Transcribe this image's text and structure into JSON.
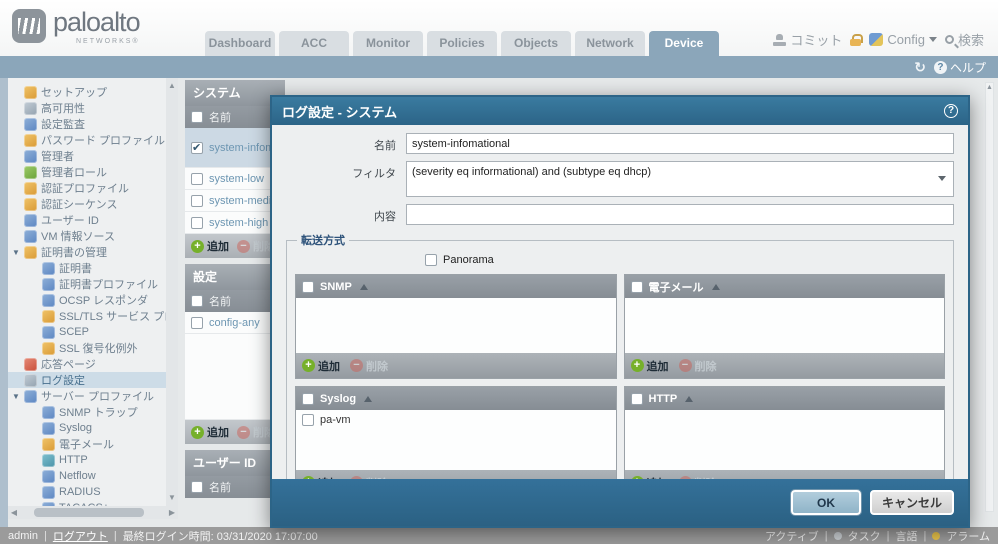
{
  "header": {
    "logo": {
      "brand": "paloalto",
      "sub": "NETWORKS®"
    },
    "tabs": [
      "Dashboard",
      "ACC",
      "Monitor",
      "Policies",
      "Objects",
      "Network",
      "Device"
    ],
    "active_tab": "Device",
    "utilities": {
      "commit": "コミット",
      "config": "Config",
      "search": "検索"
    }
  },
  "toolbar": {
    "help": "ヘルプ"
  },
  "sidebar": {
    "items": [
      {
        "label": "セットアップ"
      },
      {
        "label": "高可用性"
      },
      {
        "label": "設定監査"
      },
      {
        "label": "パスワード プロファイル"
      },
      {
        "label": "管理者"
      },
      {
        "label": "管理者ロール"
      },
      {
        "label": "認証プロファイル"
      },
      {
        "label": "認証シーケンス"
      },
      {
        "label": "ユーザー ID"
      },
      {
        "label": "VM 情報ソース"
      },
      {
        "label": "証明書の管理",
        "expanded": true
      },
      {
        "label": "証明書"
      },
      {
        "label": "証明書プロファイル"
      },
      {
        "label": "OCSP レスポンダ"
      },
      {
        "label": "SSL/TLS サービス プロファイル"
      },
      {
        "label": "SCEP"
      },
      {
        "label": "SSL 復号化例外"
      },
      {
        "label": "応答ページ"
      },
      {
        "label": "ログ設定",
        "selected": true
      },
      {
        "label": "サーバー プロファイル",
        "expanded": true
      },
      {
        "label": "SNMP トラップ"
      },
      {
        "label": "Syslog"
      },
      {
        "label": "電子メール"
      },
      {
        "label": "HTTP"
      },
      {
        "label": "Netflow"
      },
      {
        "label": "RADIUS"
      },
      {
        "label": "TACACS+"
      }
    ],
    "expander_glyph": "▼"
  },
  "actions": {
    "add": "追加",
    "remove": "削除"
  },
  "middle": {
    "system": {
      "title": "システム",
      "name_header": "名前",
      "rows": [
        "system-infomational",
        "system-low",
        "system-medium",
        "system-high"
      ]
    },
    "config": {
      "title": "設定",
      "name_header": "名前",
      "rows": [
        "config-any"
      ]
    },
    "user_id": {
      "title": "ユーザー ID",
      "name_header": "名前"
    }
  },
  "dialog": {
    "title": "ログ設定 - システム",
    "fields": {
      "name_label": "名前",
      "name_value": "system-infomational",
      "filter_label": "フィルタ",
      "filter_value": "(severity eq informational) and (subtype eq dhcp)",
      "desc_label": "内容",
      "desc_value": ""
    },
    "fieldset_title": "転送方式",
    "panorama_label": "Panorama",
    "panels": {
      "snmp": {
        "title": "SNMP"
      },
      "email": {
        "title": "電子メール"
      },
      "syslog": {
        "title": "Syslog",
        "rows": [
          "pa-vm"
        ]
      },
      "http": {
        "title": "HTTP"
      }
    },
    "buttons": {
      "ok": "OK",
      "cancel": "キャンセル"
    }
  },
  "footer": {
    "user": "admin",
    "logout": "ログアウト",
    "last_login": "最終ログイン時間: 03/31/2020 17:07:00",
    "right": [
      "アクティブ",
      "タスク",
      "言語",
      "アラーム"
    ]
  },
  "colors": {
    "titlebar": "#2c6487",
    "tab_active": "#8ba6ba",
    "add_green": "#76b02a",
    "remove_red": "#cf5a50",
    "row_link_blue": "#6d96b2",
    "selected_row": "#ccd9e4"
  }
}
